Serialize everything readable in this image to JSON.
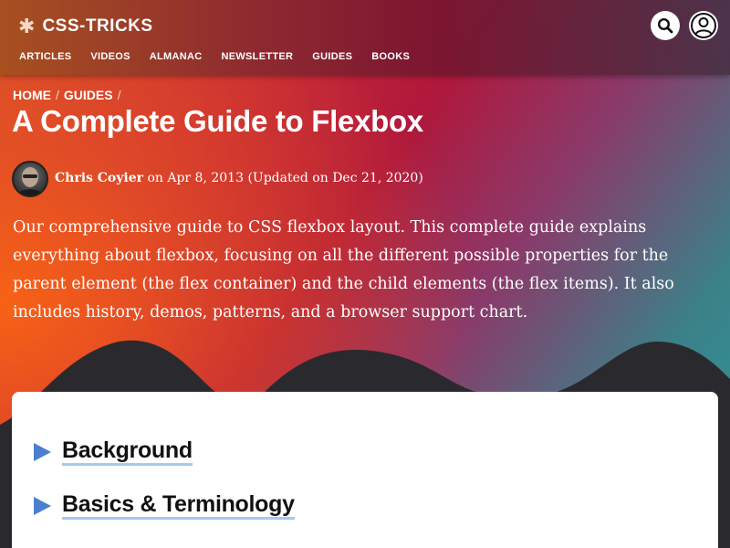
{
  "header": {
    "logo_text": "CSS-TRICKS",
    "logo_glyph": "✱",
    "nav": [
      "ARTICLES",
      "VIDEOS",
      "ALMANAC",
      "NEWSLETTER",
      "GUIDES",
      "BOOKS"
    ]
  },
  "breadcrumb": {
    "items": [
      "HOME",
      "GUIDES"
    ],
    "separator": "/"
  },
  "article": {
    "title": "A Complete Guide to Flexbox",
    "author": "Chris Coyier",
    "date_text": " on Apr 8, 2013 (Updated on Dec 21, 2020)",
    "intro": "Our comprehensive guide to CSS flexbox layout. This complete guide explains everything about flexbox, focusing on all the different possible properties for the parent element (the flex container) and the child elements (the flex items). It also includes history, demos, patterns, and a browser support chart."
  },
  "toc": {
    "items": [
      "Background",
      "Basics & Terminology"
    ]
  },
  "colors": {
    "accent_blue": "#4a7fd0",
    "underline": "#a9c8ee",
    "dark": "#2a2a2e"
  },
  "icons": {
    "search": "search-icon",
    "user": "user-icon",
    "toc_marker": "triangle-right-icon"
  }
}
